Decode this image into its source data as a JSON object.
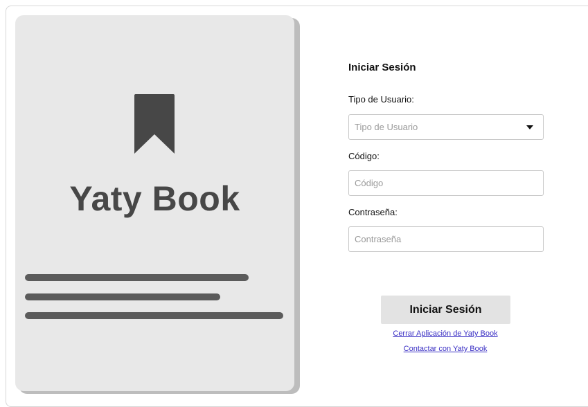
{
  "brand": {
    "name": "Yaty Book",
    "icon": "bookmark-icon",
    "color": "#474747"
  },
  "login": {
    "title": "Iniciar Sesión",
    "user_type": {
      "label": "Tipo de Usuario:",
      "placeholder": "Tipo de Usuario",
      "value": ""
    },
    "code": {
      "label": "Código:",
      "placeholder": "Código",
      "value": ""
    },
    "password": {
      "label": "Contraseña:",
      "placeholder": "Contraseña",
      "value": ""
    },
    "submit_label": "Iniciar Sesión",
    "links": {
      "close_app": "Cerrar Aplicación de Yaty Book",
      "contact": "Contactar con Yaty Book"
    }
  },
  "colors": {
    "panel_bg": "#e8e8e8",
    "button_bg": "#e3e3e3",
    "link": "#3a2fc4"
  }
}
